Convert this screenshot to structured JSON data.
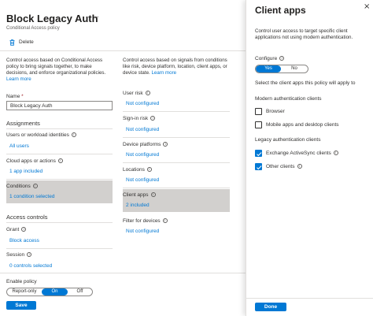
{
  "header": {
    "title": "Block Legacy Auth",
    "more_label": "···",
    "subtitle": "Conditional Access policy"
  },
  "toolbar": {
    "delete_label": "Delete"
  },
  "left": {
    "description": "Control access based on Conditional Access policy to bring signals together, to make decisions, and enforce organizational policies.",
    "learn_more": "Learn more",
    "name_label": "Name",
    "name_required": "*",
    "name_value": "Block Legacy Auth",
    "assignments_heading": "Assignments",
    "users_label": "Users or workload identities",
    "users_value": "All users",
    "cloud_label": "Cloud apps or actions",
    "cloud_value": "1 app included",
    "conditions_label": "Conditions",
    "conditions_value": "1 condition selected",
    "access_controls_heading": "Access controls",
    "grant_label": "Grant",
    "grant_value": "Block access",
    "session_label": "Session",
    "session_value": "0 controls selected"
  },
  "middle": {
    "description": "Control access based on signals from conditions like risk, device platform, location, client apps, or device state.",
    "learn_more": "Learn more",
    "conditions": [
      {
        "label": "User risk",
        "value": "Not configured"
      },
      {
        "label": "Sign-in risk",
        "value": "Not configured"
      },
      {
        "label": "Device platforms",
        "value": "Not configured"
      },
      {
        "label": "Locations",
        "value": "Not configured"
      },
      {
        "label": "Client apps",
        "value": "2 included"
      },
      {
        "label": "Filter for devices",
        "value": "Not configured"
      }
    ]
  },
  "footer": {
    "enable_label": "Enable policy",
    "options": [
      "Report-only",
      "On",
      "Off"
    ],
    "selected": "On",
    "save_label": "Save"
  },
  "panel": {
    "title": "Client apps",
    "close_label": "×",
    "description": "Control user access to target specific client applications not using modern authentication.",
    "configure_label": "Configure",
    "configure_yes": "Yes",
    "configure_no": "No",
    "configure_selected": "Yes",
    "select_prompt": "Select the client apps this policy will apply to",
    "modern_heading": "Modern authentication clients",
    "browser_label": "Browser",
    "browser_checked": false,
    "mobile_label": "Mobile apps and desktop clients",
    "mobile_checked": false,
    "legacy_heading": "Legacy authentication clients",
    "exchange_label": "Exchange ActiveSync clients",
    "exchange_checked": true,
    "other_label": "Other clients",
    "other_checked": true,
    "done_label": "Done"
  },
  "colors": {
    "accent": "#0078d4",
    "selected_row": "#d2d0ce",
    "divider": "#e1dfdd"
  },
  "icons": {
    "delete": "trash-icon",
    "info": "info-icon",
    "close": "close-icon"
  }
}
